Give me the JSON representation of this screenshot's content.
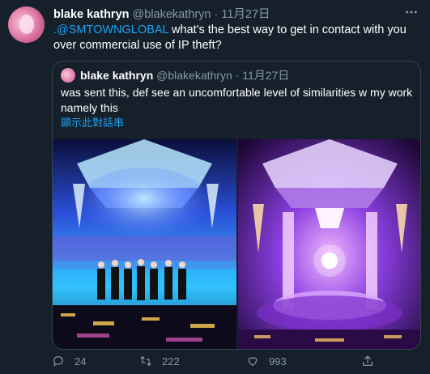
{
  "tweet": {
    "author_name": "blake kathryn",
    "author_handle": "@blakekathryn",
    "separator": "·",
    "date": "11月27日",
    "mention": ".@SMTOWNGLOBAL",
    "text": " what's the best way to get in contact with you over commercial use of IP theft?",
    "more_icon": "more-dots-icon"
  },
  "quote": {
    "author_name": "blake kathryn",
    "author_handle": "@blakekathryn",
    "separator": "·",
    "date": "11月27日",
    "text": "was sent this, def see an uncomfortable level of similarities w my work namely this",
    "show_thread": "顯示此對話串"
  },
  "actions": {
    "reply_count": "24",
    "retweet_count": "222",
    "like_count": "993"
  },
  "colors": {
    "background": "#15202b",
    "text": "#ffffff",
    "muted": "#8899a6",
    "accent": "#1da1f2",
    "border": "#38444d"
  }
}
